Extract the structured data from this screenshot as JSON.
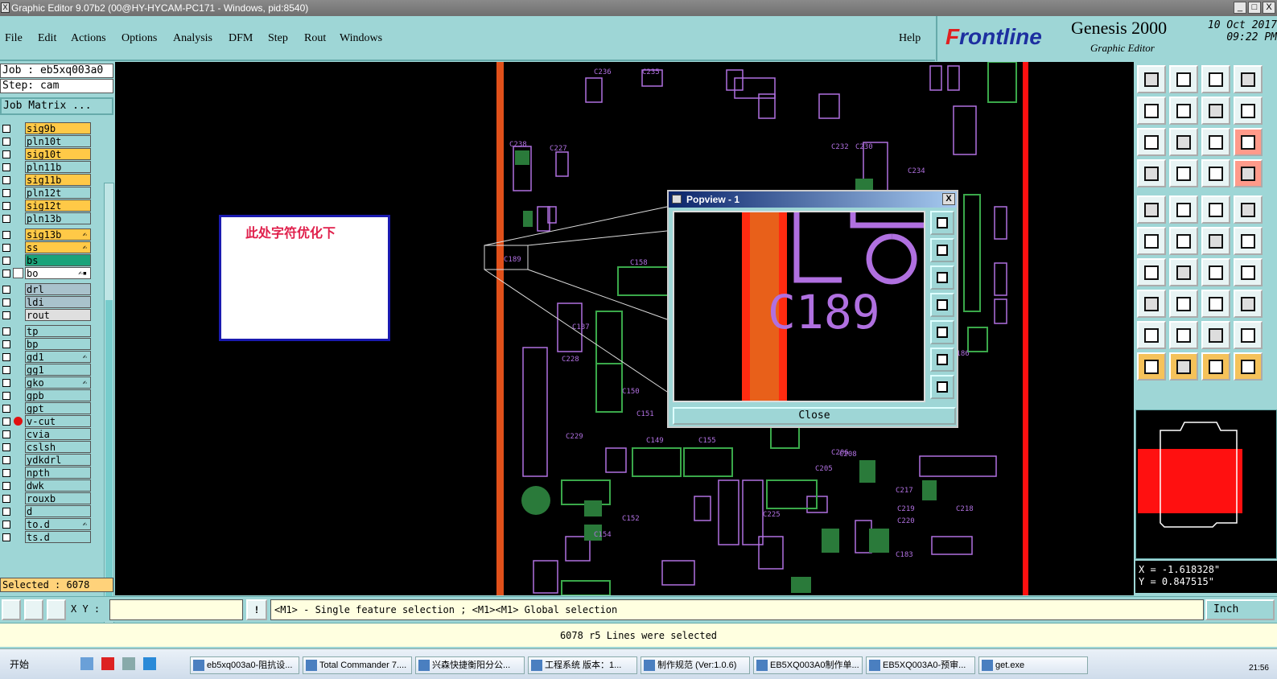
{
  "window": {
    "title": "Graphic Editor 9.07b2 (00@HY-HYCAM-PC171 - Windows, pid:8540)",
    "min": "_",
    "max": "□",
    "close": "X"
  },
  "menu": {
    "items": [
      "File",
      "Edit",
      "Actions",
      "Options",
      "Analysis",
      "DFM",
      "Step",
      "Rout",
      "Windows"
    ],
    "help": "Help"
  },
  "brand": {
    "logo_f": "F",
    "logo_rest": "rontline",
    "product": "Genesis 2000",
    "subtitle": "Graphic Editor",
    "date": "10 Oct 2017",
    "time": "09:22 PM"
  },
  "job": {
    "job_label": "Job : eb5xq003a0",
    "step_label": "Step: cam",
    "matrix_button": "Job Matrix ..."
  },
  "layers": [
    {
      "name": "sig9b",
      "color": "#ffc947"
    },
    {
      "name": "pln10t",
      "color": "#9ed6d6"
    },
    {
      "name": "sig10t",
      "color": "#ffc947"
    },
    {
      "name": "pln11b",
      "color": "#9ed6d6"
    },
    {
      "name": "sig11b",
      "color": "#ffc947"
    },
    {
      "name": "pln12t",
      "color": "#9ed6d6"
    },
    {
      "name": "sig12t",
      "color": "#ffc947"
    },
    {
      "name": "pln13b",
      "color": "#9ed6d6"
    },
    {
      "name": "sig13b",
      "color": "#ffc947",
      "mark": "✍"
    },
    {
      "name": "ss",
      "color": "#ffc947",
      "mark": "✍"
    },
    {
      "name": "bs",
      "color": "#1aa37a"
    },
    {
      "name": "bo",
      "color": "#ffffff",
      "mark": "✍▪"
    },
    {
      "name": "drl",
      "color": "#a9c2cc"
    },
    {
      "name": "ldi",
      "color": "#a9c2cc"
    },
    {
      "name": "rout",
      "color": "#dfdfdf"
    },
    {
      "name": "tp",
      "color": "#9ed6d6"
    },
    {
      "name": "bp",
      "color": "#9ed6d6"
    },
    {
      "name": "gd1",
      "color": "#9ed6d6",
      "mark": "✍"
    },
    {
      "name": "gg1",
      "color": "#9ed6d6"
    },
    {
      "name": "gko",
      "color": "#9ed6d6",
      "mark": "✍"
    },
    {
      "name": "gpb",
      "color": "#9ed6d6"
    },
    {
      "name": "gpt",
      "color": "#9ed6d6"
    },
    {
      "name": "v-cut",
      "color": "#9ed6d6"
    },
    {
      "name": "cvia",
      "color": "#9ed6d6"
    },
    {
      "name": "cslsh",
      "color": "#9ed6d6"
    },
    {
      "name": "ydkdrl",
      "color": "#9ed6d6"
    },
    {
      "name": "npth",
      "color": "#9ed6d6"
    },
    {
      "name": "dwk",
      "color": "#9ed6d6"
    },
    {
      "name": "rouxb",
      "color": "#9ed6d6"
    },
    {
      "name": "d",
      "color": "#9ed6d6"
    },
    {
      "name": "to.d",
      "color": "#9ed6d6",
      "mark": "✍"
    },
    {
      "name": "ts.d",
      "color": "#9ed6d6"
    }
  ],
  "selected": "Selected : 6078",
  "canvas": {
    "note": "此处字符优化下",
    "labels": [
      "C189",
      "C158",
      "C137",
      "C150",
      "C151",
      "C149",
      "C155",
      "C152",
      "C154",
      "C225",
      "C205",
      "C206",
      "C183",
      "C186",
      "C208",
      "C217",
      "C219",
      "C220",
      "C218",
      "C234",
      "C227",
      "C228",
      "C229",
      "C230",
      "C232",
      "C238",
      "C236",
      "C235"
    ]
  },
  "popup": {
    "title": "Popview - 1",
    "zoom_text": "C189",
    "close": "Close"
  },
  "coords": {
    "x": "X = -1.618328\"",
    "y": "Y =  0.847515\""
  },
  "status": {
    "xy_label": "X Y :",
    "xy_value": "",
    "excl": "!",
    "hint": "<M1> - Single feature selection ; <M1><M1> Global selection",
    "unit": "Inch",
    "message": "6078 r5 Lines were selected"
  },
  "taskbar": {
    "start": "开始",
    "clock": "21:56",
    "tasks": [
      "eb5xq003a0-阻抗设...",
      "Total Commander 7....",
      "兴森快捷衡阳分公...",
      "工程系统  版本：1...",
      "制作规范 (Ver:1.0.6)",
      "EB5XQ003A0制作单...",
      "EB5XQ003A0-预审...",
      "get.exe"
    ]
  }
}
